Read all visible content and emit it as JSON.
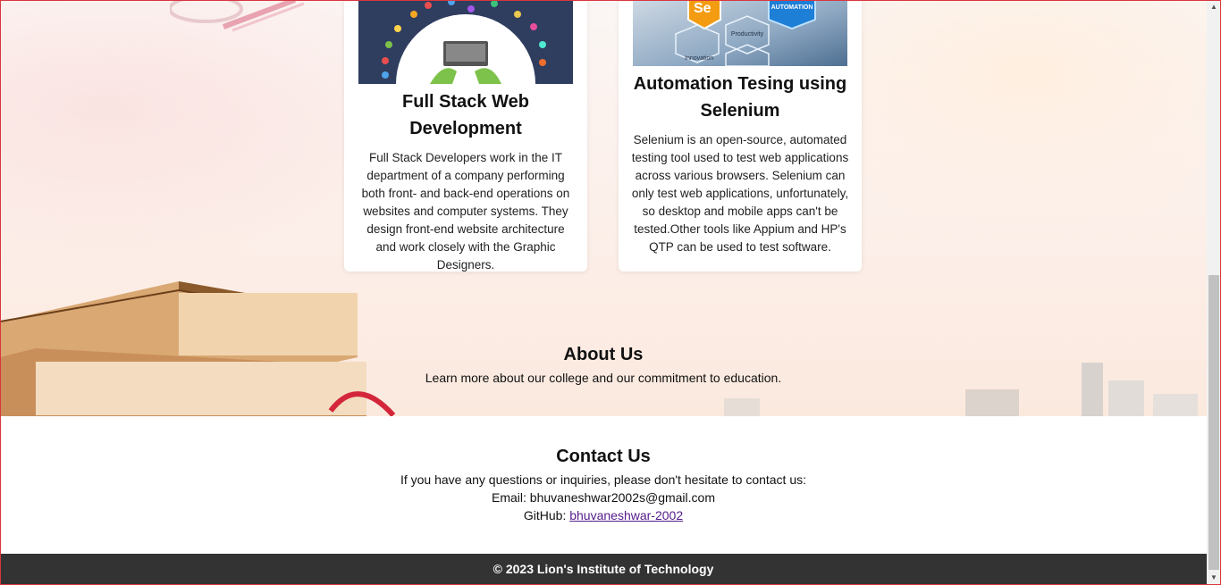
{
  "cards": [
    {
      "title": "Full Stack Web Development",
      "text": "Full Stack Developers work in the IT department of a company performing both front- and back-end operations on websites and computer systems. They design front-end website architecture and work closely with the Graphic Designers."
    },
    {
      "title": "Automation Tesing using Selenium",
      "text": "Selenium is an open-source, automated testing tool used to test web applications across various browsers. Selenium can only test web applications, unfortunately, so desktop and mobile apps can't be tested.Other tools like Appium and HP's QTP can be used to test software.",
      "image_labels": {
        "logo": "Se",
        "automation": "AUTOMATION",
        "productivity": "Productivity",
        "innovation": "Innovation"
      }
    }
  ],
  "about": {
    "title": "About Us",
    "text": "Learn more about our college and our commitment to education."
  },
  "contact": {
    "title": "Contact Us",
    "intro": "If you have any questions or inquiries, please don't hesitate to contact us:",
    "email_label": "Email:",
    "email": "bhuvaneshwar2002s@gmail.com",
    "github_label": "GitHub:",
    "github_link": "bhuvaneshwar-2002"
  },
  "footer": {
    "text": "© 2023 Lion's Institute of Technology"
  },
  "colors": {
    "footer_bg": "#333333",
    "link": "#551a8b"
  }
}
